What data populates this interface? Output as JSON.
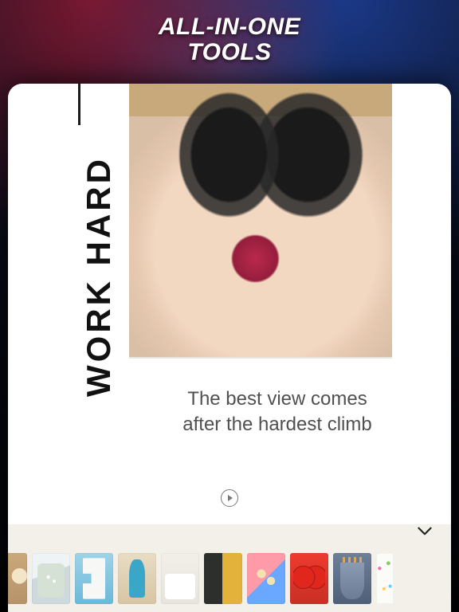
{
  "banner": {
    "line1": "ALL-IN-ONE",
    "line2": "TOOLS"
  },
  "card": {
    "vertical_label": "WORK HARD",
    "quote_line1": "The best view comes",
    "quote_line2": "after the hardest climb"
  },
  "controls": {
    "play_label": "play",
    "collapse_label": "collapse"
  },
  "thumbnails": [
    {
      "name": "template-lamp"
    },
    {
      "name": "template-flowers"
    },
    {
      "name": "template-sky-arch"
    },
    {
      "name": "template-arch-door"
    },
    {
      "name": "template-bathroom"
    },
    {
      "name": "template-split-yellow"
    },
    {
      "name": "template-join-us"
    },
    {
      "name": "template-apples"
    },
    {
      "name": "template-brushes"
    },
    {
      "name": "template-confetti"
    }
  ]
}
